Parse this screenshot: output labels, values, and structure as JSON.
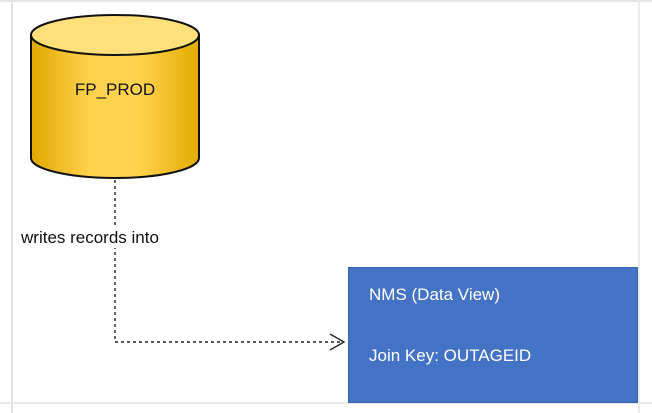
{
  "database": {
    "label": "FP_PROD",
    "color": "#ffd24d"
  },
  "connector": {
    "label": "writes records into"
  },
  "entity": {
    "title": "NMS (Data View)",
    "join_key": "Join Key: OUTAGEID",
    "color": "#4473c5"
  }
}
